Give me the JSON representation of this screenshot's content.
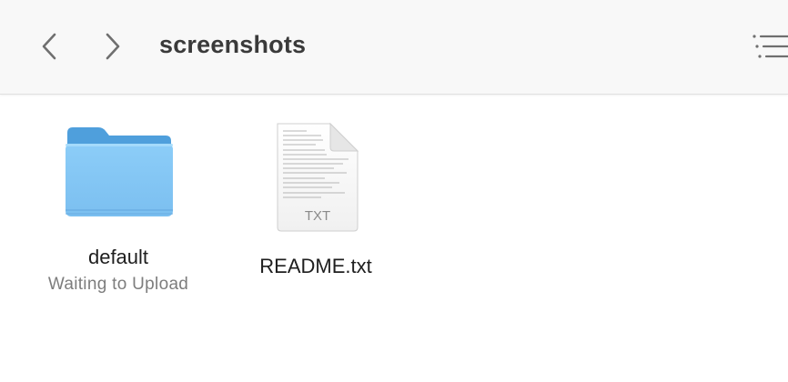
{
  "window": {
    "title": "screenshots"
  },
  "toolbar": {
    "back_icon": "chevron-left-icon",
    "forward_icon": "chevron-right-icon",
    "view_options_icon": "list-view-icon"
  },
  "items": [
    {
      "name": "default",
      "kind": "folder",
      "icon": "folder-icon",
      "status": "Waiting to Upload",
      "color": "#7ec3f2"
    },
    {
      "name": "README.txt",
      "kind": "text-file",
      "icon": "text-document-icon",
      "badge": "TXT"
    }
  ],
  "colors": {
    "folder_body": "#86c8f6",
    "folder_tab": "#5aa6df",
    "toolbar_bg": "#f8f8f8",
    "title_text": "#3a3a3a",
    "status_text": "#7d7d7d"
  }
}
